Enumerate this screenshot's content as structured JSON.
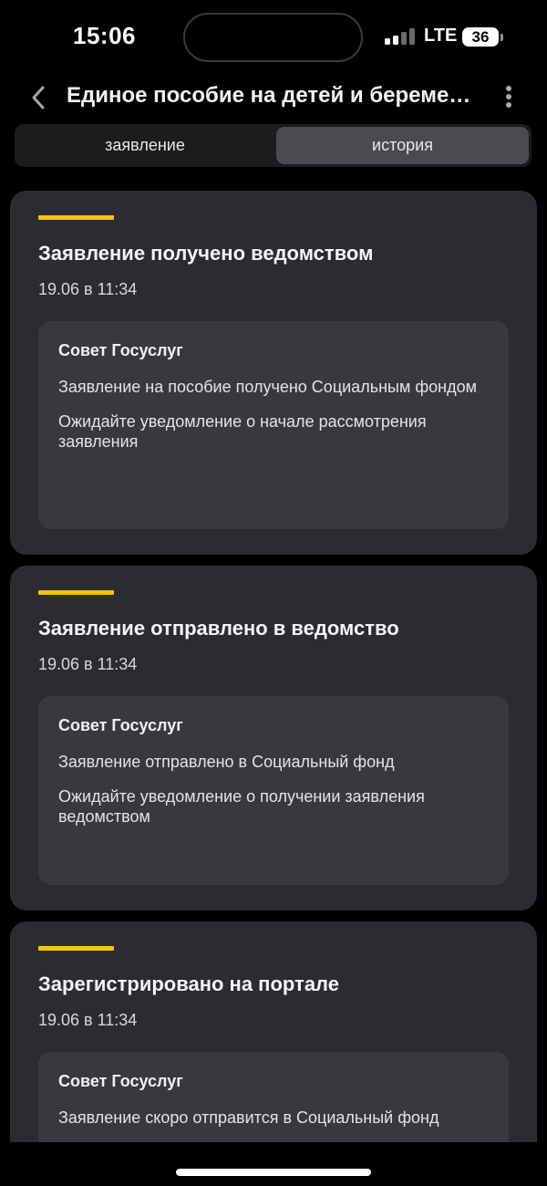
{
  "status_bar": {
    "time": "15:06",
    "network": "LTE",
    "battery": "36",
    "signal_bars_active": 2,
    "signal_bars_total": 4
  },
  "header": {
    "title": "Единое пособие на детей и беременным",
    "back_icon": "chevron-left-icon",
    "menu_icon": "more-vertical-icon"
  },
  "tabs": [
    {
      "label": "заявление",
      "selected": false
    },
    {
      "label": "история",
      "selected": true
    }
  ],
  "history": [
    {
      "title": "Заявление получено ведомством",
      "date": "19.06 в 11:34",
      "advice_title": "Совет Госуслуг",
      "advice_lines": [
        "Заявление на пособие получено Социальным фондом",
        "Ожидайте уведомление о начале рассмотрения заявления"
      ]
    },
    {
      "title": "Заявление отправлено в ведомство",
      "date": "19.06 в 11:34",
      "advice_title": "Совет Госуслуг",
      "advice_lines": [
        "Заявление отправлено в Социальный фонд",
        "Ожидайте уведомление о получении заявления ведомством"
      ]
    },
    {
      "title": "Зарегистрировано на портале",
      "date": "19.06 в 11:34",
      "advice_title": "Совет Госуслуг",
      "advice_lines": [
        "Заявление скоро отправится в Социальный фонд"
      ]
    }
  ],
  "colors": {
    "accent": "#f6c500",
    "card": "#2b2c31",
    "advice_box": "#38393e",
    "background": "#000000"
  }
}
